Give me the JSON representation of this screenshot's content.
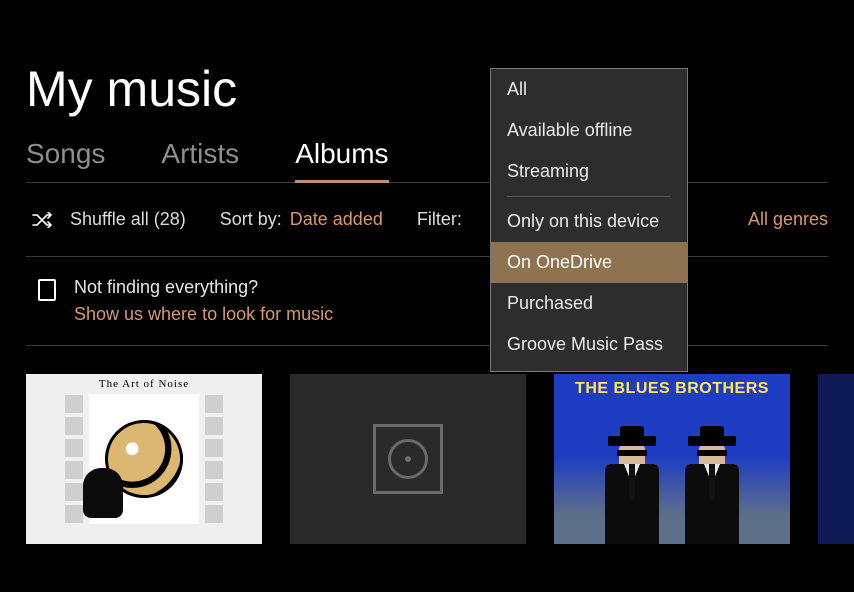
{
  "pageTitle": "My music",
  "tabs": [
    {
      "label": "Songs",
      "active": false
    },
    {
      "label": "Artists",
      "active": false
    },
    {
      "label": "Albums",
      "active": true
    }
  ],
  "toolbar": {
    "shuffleLabel": "Shuffle all (28)",
    "sortLabel": "Sort by:",
    "sortValue": "Date added",
    "filterLabel": "Filter:",
    "genreLink": "All genres"
  },
  "hint": {
    "line1": "Not finding everything?",
    "line2": "Show us where to look for music"
  },
  "filterMenu": {
    "items": [
      "All",
      "Available offline",
      "Streaming",
      "Only on this device",
      "On OneDrive",
      "Purchased",
      "Groove Music Pass"
    ],
    "separatorAfterIndex": 2,
    "selected": "On OneDrive"
  },
  "albums": [
    {
      "caption": "The Art of Noise"
    },
    {
      "caption": ""
    },
    {
      "caption": "THE BLUES BROTHERS"
    },
    {
      "caption": ""
    }
  ]
}
